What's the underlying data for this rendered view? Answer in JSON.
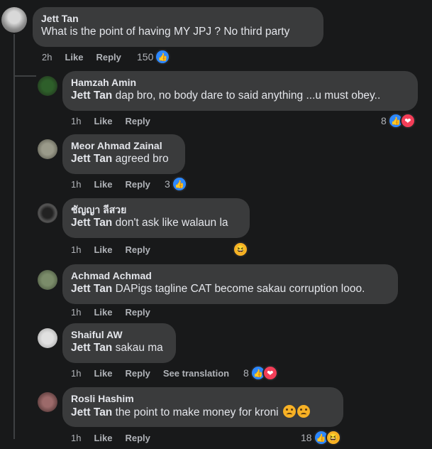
{
  "comments": [
    {
      "author": "Jett Tan",
      "tag": "",
      "text": "What is the point of having MY JPJ ? No third party",
      "time": "2h",
      "like": "Like",
      "reply": "Reply",
      "count": "150",
      "reactions": [
        "like"
      ]
    },
    {
      "author": "Hamzah Amin",
      "tag": "Jett Tan",
      "text": "dap bro, no body dare to said anything ...u must obey..",
      "time": "1h",
      "like": "Like",
      "reply": "Reply",
      "count": "8",
      "reactions": [
        "like",
        "love"
      ]
    },
    {
      "author": "Meor Ahmad Zainal",
      "tag": "Jett Tan",
      "text": "agreed bro",
      "time": "1h",
      "like": "Like",
      "reply": "Reply",
      "count": "3",
      "reactions": [
        "like"
      ]
    },
    {
      "author": "ชัญญา ลีสวย",
      "tag": "Jett Tan",
      "text": "don't ask like walaun la",
      "time": "1h",
      "like": "Like",
      "reply": "Reply",
      "count": "",
      "reactions": [
        "haha"
      ]
    },
    {
      "author": "Achmad Achmad",
      "tag": "Jett Tan",
      "text": "DAPigs tagline CAT become sakau corruption looo.",
      "time": "1h",
      "like": "Like",
      "reply": "Reply",
      "count": "",
      "reactions": []
    },
    {
      "author": "Shaiful AW",
      "tag": "Jett Tan",
      "text": "sakau ma",
      "time": "1h",
      "like": "Like",
      "reply": "Reply",
      "translate": "See translation",
      "count": "8",
      "reactions": [
        "like",
        "love"
      ]
    },
    {
      "author": "Rosli Hashim",
      "tag": "Jett Tan",
      "text": "the point to make money for kroni",
      "time": "1h",
      "like": "Like",
      "reply": "Reply",
      "count": "18",
      "reactions": [
        "like",
        "haha"
      ]
    }
  ],
  "colors": {
    "background": "#18191a",
    "bubble": "#3a3b3c",
    "like": "#2d88ff",
    "love": "#f33e58",
    "haha": "#f7b125"
  }
}
